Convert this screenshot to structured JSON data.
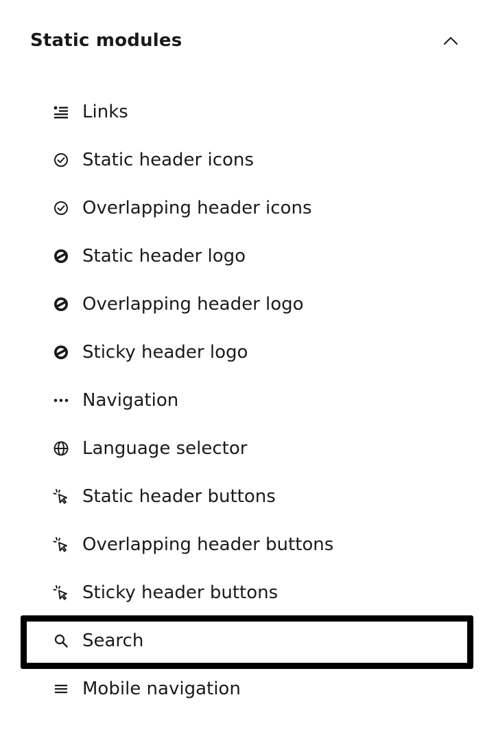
{
  "section": {
    "title": "Static modules",
    "collapse_icon": "chevron-up-icon"
  },
  "modules": [
    {
      "label": "Links",
      "icon": "links-list-icon"
    },
    {
      "label": "Static header icons",
      "icon": "check-circle-icon"
    },
    {
      "label": "Overlapping header icons",
      "icon": "check-circle-icon"
    },
    {
      "label": "Static header logo",
      "icon": "logo-icon"
    },
    {
      "label": "Overlapping header logo",
      "icon": "logo-icon"
    },
    {
      "label": "Sticky header logo",
      "icon": "logo-icon"
    },
    {
      "label": "Navigation",
      "icon": "ellipsis-icon"
    },
    {
      "label": "Language selector",
      "icon": "globe-icon"
    },
    {
      "label": "Static header buttons",
      "icon": "cursor-click-icon"
    },
    {
      "label": "Overlapping header buttons",
      "icon": "cursor-click-icon"
    },
    {
      "label": "Sticky header buttons",
      "icon": "cursor-click-icon"
    },
    {
      "label": "Search",
      "icon": "search-icon"
    },
    {
      "label": "Mobile navigation",
      "icon": "hamburger-menu-icon"
    }
  ],
  "selected_index": 11,
  "colors": {
    "text": "#1a1a1a",
    "highlight_border": "#000000",
    "background": "#ffffff"
  }
}
